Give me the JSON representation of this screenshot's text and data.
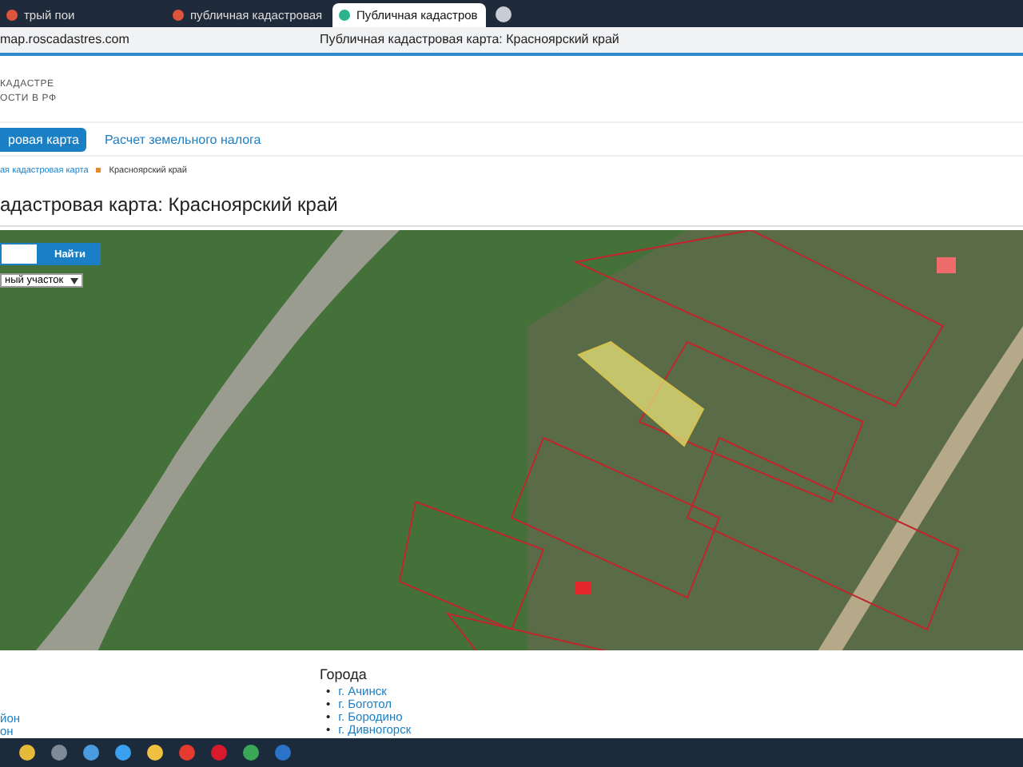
{
  "browser": {
    "tabs": [
      {
        "title": "трый пои",
        "selected": false
      },
      {
        "title": "публичная кадастровая",
        "selected": false
      },
      {
        "title": "Публичная кадастров",
        "selected": true
      }
    ],
    "address": "map.roscadastres.com",
    "page_title": "Публичная кадастровая карта: Красноярский край"
  },
  "header": {
    "logo_lines": [
      "КАДАСТРЕ",
      "ОСТИ В РФ"
    ]
  },
  "nav": [
    {
      "label": "ровая карта",
      "selected": true
    },
    {
      "label": "Расчет земельного налога",
      "selected": false
    }
  ],
  "breadcrumbs": [
    "ая кадастровая карта",
    "Красноярский край"
  ],
  "heading": "адастровая карта: Красноярский край",
  "map": {
    "search_button": "Найти",
    "object_type": "ный участок"
  },
  "footer": {
    "left_links": [
      "йон",
      "он"
    ],
    "section_title": "Города",
    "bullet": "•",
    "cities": [
      "г. Ачинск",
      "г. Боготол",
      "г. Бородино",
      "г. Дивногорск"
    ]
  }
}
